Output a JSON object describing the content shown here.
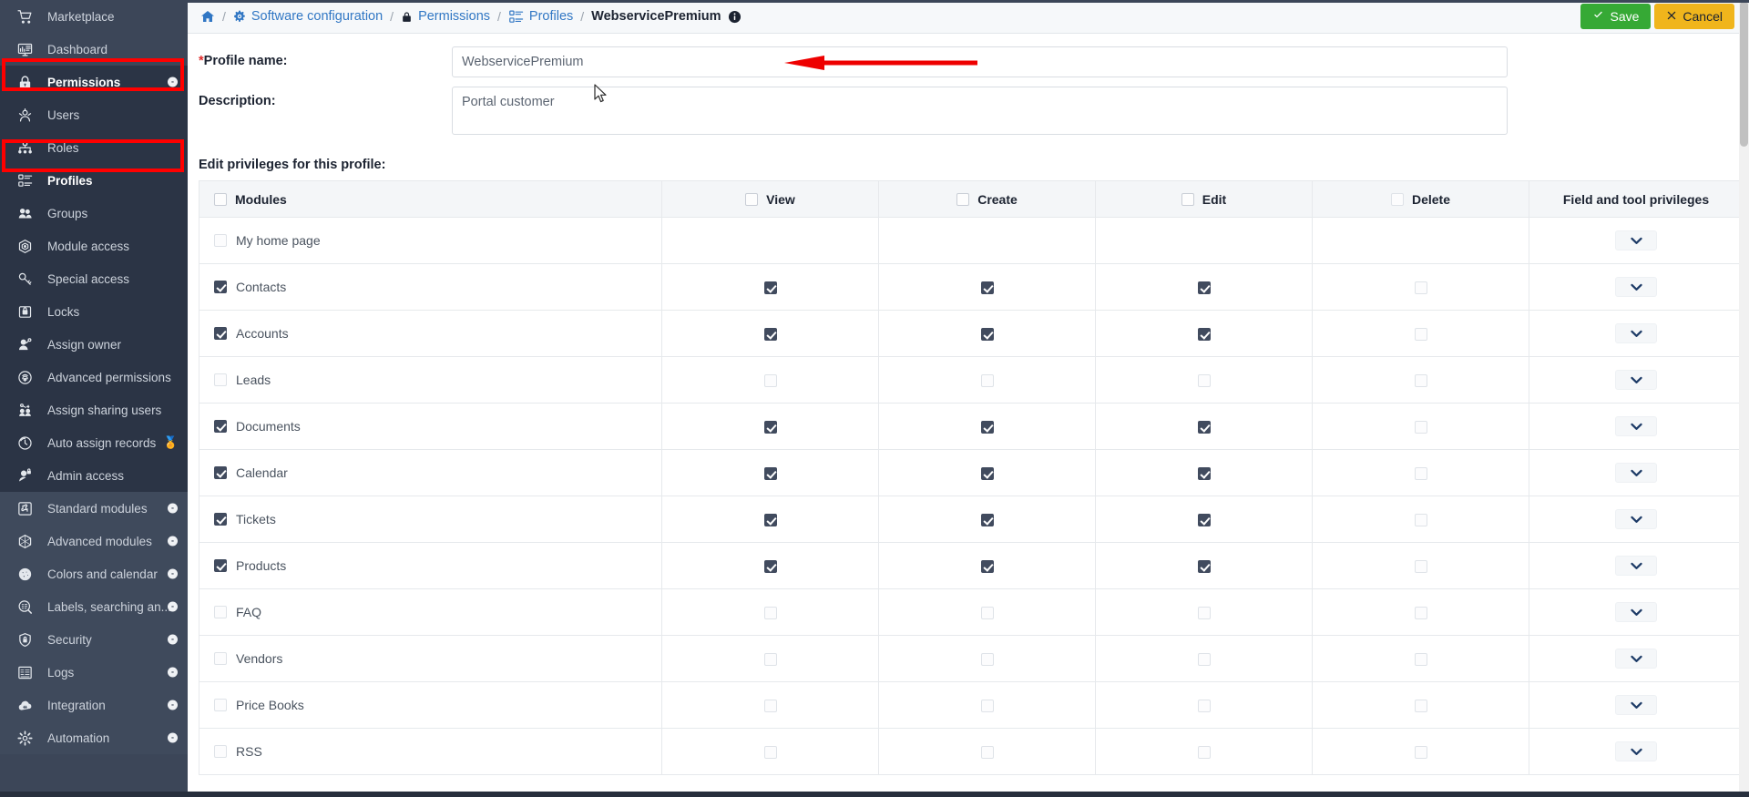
{
  "sidebar": {
    "items": [
      {
        "label": "Marketplace",
        "icon": "cart-icon",
        "group": "top",
        "active": false,
        "badge": null,
        "trophy": false
      },
      {
        "label": "Dashboard",
        "icon": "dashboard-icon",
        "group": "top",
        "active": false,
        "badge": null,
        "trophy": false
      },
      {
        "label": "Permissions",
        "icon": "lock-icon",
        "group": "dark",
        "active": true,
        "badge": "-",
        "trophy": false
      },
      {
        "label": "Users",
        "icon": "users-icon",
        "group": "dark",
        "active": false,
        "badge": null,
        "trophy": false
      },
      {
        "label": "Roles",
        "icon": "roles-icon",
        "group": "dark",
        "active": false,
        "badge": null,
        "trophy": false
      },
      {
        "label": "Profiles",
        "icon": "profiles-icon",
        "group": "dark",
        "active": true,
        "badge": null,
        "trophy": false
      },
      {
        "label": "Groups",
        "icon": "groups-icon",
        "group": "dark",
        "active": false,
        "badge": null,
        "trophy": false
      },
      {
        "label": "Module access",
        "icon": "module-access-icon",
        "group": "dark",
        "active": false,
        "badge": null,
        "trophy": false
      },
      {
        "label": "Special access",
        "icon": "key-icon",
        "group": "dark",
        "active": false,
        "badge": null,
        "trophy": false
      },
      {
        "label": "Locks",
        "icon": "locks-icon",
        "group": "dark",
        "active": false,
        "badge": null,
        "trophy": false
      },
      {
        "label": "Assign owner",
        "icon": "assign-owner-icon",
        "group": "dark",
        "active": false,
        "badge": null,
        "trophy": false
      },
      {
        "label": "Advanced permissions",
        "icon": "fingerprint-icon",
        "group": "dark",
        "active": false,
        "badge": null,
        "trophy": false
      },
      {
        "label": "Assign sharing users",
        "icon": "assign-sharing-icon",
        "group": "dark",
        "active": false,
        "badge": null,
        "trophy": false
      },
      {
        "label": "Auto assign records",
        "icon": "auto-assign-icon",
        "group": "dark",
        "active": false,
        "badge": null,
        "trophy": true
      },
      {
        "label": "Admin access",
        "icon": "admin-access-icon",
        "group": "dark",
        "active": false,
        "badge": null,
        "trophy": false
      },
      {
        "label": "Standard modules",
        "icon": "puzzle-icon",
        "group": "mid",
        "active": false,
        "badge": "-",
        "trophy": false
      },
      {
        "label": "Advanced modules",
        "icon": "cube-icon",
        "group": "mid",
        "active": false,
        "badge": "-",
        "trophy": false
      },
      {
        "label": "Colors and calendar",
        "icon": "palette-icon",
        "group": "mid",
        "active": false,
        "badge": "-",
        "trophy": false
      },
      {
        "label": "Labels, searching an...",
        "icon": "label-search-icon",
        "group": "mid",
        "active": false,
        "badge": "-",
        "trophy": false
      },
      {
        "label": "Security",
        "icon": "shield-icon",
        "group": "mid",
        "active": false,
        "badge": "-",
        "trophy": false
      },
      {
        "label": "Logs",
        "icon": "logs-icon",
        "group": "mid",
        "active": false,
        "badge": "-",
        "trophy": false
      },
      {
        "label": "Integration",
        "icon": "integration-icon",
        "group": "mid",
        "active": false,
        "badge": "-",
        "trophy": false
      },
      {
        "label": "Automation",
        "icon": "automation-icon",
        "group": "mid",
        "active": false,
        "badge": "-",
        "trophy": false
      }
    ],
    "highlight_color": "#ff0000"
  },
  "breadcrumb": {
    "home_icon": "home-icon",
    "items": [
      {
        "label": "Software configuration",
        "icon": "gear-icon",
        "current": false
      },
      {
        "label": "Permissions",
        "icon": "lock-icon",
        "current": false
      },
      {
        "label": "Profiles",
        "icon": "profiles-icon",
        "current": false
      },
      {
        "label": "WebservicePremium",
        "icon": "info-icon",
        "current": true
      }
    ],
    "separator": "/"
  },
  "toolbar": {
    "save_label": "Save",
    "save_icon": "check-icon",
    "save_color": "#36a935",
    "cancel_label": "Cancel",
    "cancel_icon": "close-icon",
    "cancel_color": "#f0b51c"
  },
  "form": {
    "profile_name_label": "Profile name:",
    "profile_name_required": "*",
    "profile_name_value": "WebservicePremium",
    "profile_name_placeholder": "Profile name",
    "description_label": "Description:",
    "description_value": "Portal customer",
    "description_placeholder": "Description"
  },
  "privileges": {
    "section_title": "Edit privileges for this profile:",
    "columns": [
      "Modules",
      "View",
      "Create",
      "Edit",
      "Delete",
      "Field and tool privileges"
    ],
    "header_checkboxes": [
      false,
      false,
      false,
      false,
      false
    ],
    "expand_icon": "chevron-down-icon",
    "rows": [
      {
        "module": "My home page",
        "module_checked": false,
        "view": null,
        "create": null,
        "edit": null,
        "delete": null,
        "tools": true
      },
      {
        "module": "Contacts",
        "module_checked": true,
        "view": true,
        "create": true,
        "edit": true,
        "delete": false,
        "tools": true
      },
      {
        "module": "Accounts",
        "module_checked": true,
        "view": true,
        "create": true,
        "edit": true,
        "delete": false,
        "tools": true
      },
      {
        "module": "Leads",
        "module_checked": false,
        "view": false,
        "create": false,
        "edit": false,
        "delete": false,
        "tools": true
      },
      {
        "module": "Documents",
        "module_checked": true,
        "view": true,
        "create": true,
        "edit": true,
        "delete": false,
        "tools": true
      },
      {
        "module": "Calendar",
        "module_checked": true,
        "view": true,
        "create": true,
        "edit": true,
        "delete": false,
        "tools": true
      },
      {
        "module": "Tickets",
        "module_checked": true,
        "view": true,
        "create": true,
        "edit": true,
        "delete": false,
        "tools": true
      },
      {
        "module": "Products",
        "module_checked": true,
        "view": true,
        "create": true,
        "edit": true,
        "delete": false,
        "tools": true
      },
      {
        "module": "FAQ",
        "module_checked": false,
        "view": false,
        "create": false,
        "edit": false,
        "delete": false,
        "tools": true
      },
      {
        "module": "Vendors",
        "module_checked": false,
        "view": false,
        "create": false,
        "edit": false,
        "delete": false,
        "tools": true
      },
      {
        "module": "Price Books",
        "module_checked": false,
        "view": false,
        "create": false,
        "edit": false,
        "delete": false,
        "tools": true
      },
      {
        "module": "RSS",
        "module_checked": false,
        "view": false,
        "create": false,
        "edit": false,
        "delete": false,
        "tools": true
      }
    ]
  },
  "annotations": {
    "arrow_color": "#ee0000",
    "arrow_target": "profile-name-input"
  }
}
